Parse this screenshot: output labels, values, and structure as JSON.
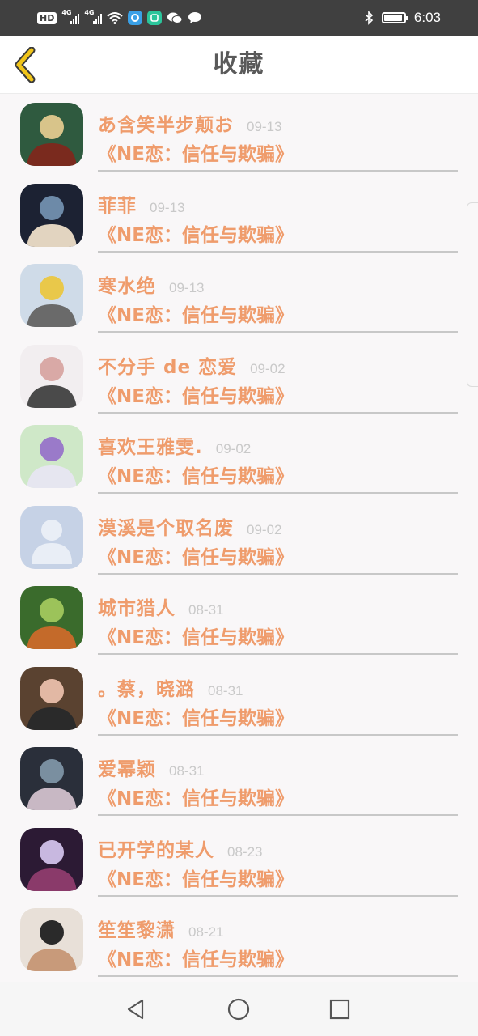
{
  "status_bar": {
    "hd_badge": "HD",
    "sim1_gen": "4G",
    "sim2_gen": "4G",
    "time": "6:03",
    "battery_level": 0.9,
    "icons": [
      "hd-icon",
      "signal-icon",
      "signal-icon",
      "wifi-icon",
      "app-icon",
      "app-icon",
      "wechat-icon",
      "chat-bubble-icon",
      "bluetooth-icon",
      "battery-icon"
    ]
  },
  "header": {
    "title": "收藏",
    "back_icon": "chevron-left-icon",
    "accent_color": "#f0c419"
  },
  "colors": {
    "accent_text": "#ef9c6c",
    "date_text": "#c9c9c9",
    "title_text": "#5a5a5a"
  },
  "favorites": [
    {
      "name": "あ含笑半步颠お",
      "date": "09-13",
      "book": "《NE恋：信任与欺骗》"
    },
    {
      "name": "菲菲",
      "date": "09-13",
      "book": "《NE恋：信任与欺骗》"
    },
    {
      "name": "寒水绝",
      "date": "09-13",
      "book": "《NE恋：信任与欺骗》"
    },
    {
      "name": "不分手 de 恋爱",
      "date": "09-02",
      "book": "《NE恋：信任与欺骗》"
    },
    {
      "name": "喜欢王雅雯.",
      "date": "09-02",
      "book": "《NE恋：信任与欺骗》"
    },
    {
      "name": "漠溪是个取名废",
      "date": "09-02",
      "book": "《NE恋：信任与欺骗》"
    },
    {
      "name": "城市猎人",
      "date": "08-31",
      "book": "《NE恋：信任与欺骗》"
    },
    {
      "name": "。蔡，晓潞",
      "date": "08-31",
      "book": "《NE恋：信任与欺骗》"
    },
    {
      "name": "爱幂颖",
      "date": "08-31",
      "book": "《NE恋：信任与欺骗》"
    },
    {
      "name": "已开学的某人",
      "date": "08-23",
      "book": "《NE恋：信任与欺骗》"
    },
    {
      "name": "笙笙黎潇",
      "date": "08-21",
      "book": "《NE恋：信任与欺骗》"
    }
  ],
  "nav_bar": {
    "buttons": [
      "back-triangle-icon",
      "home-circle-icon",
      "recents-square-icon"
    ]
  }
}
